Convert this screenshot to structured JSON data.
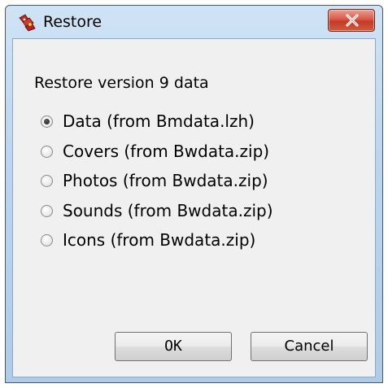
{
  "window": {
    "title": "Restore"
  },
  "dialog": {
    "heading": "Restore version 9 data",
    "options": [
      {
        "label": "Data (from Bmdata.lzh)",
        "checked": true
      },
      {
        "label": "Covers (from Bwdata.zip)",
        "checked": false
      },
      {
        "label": "Photos (from Bwdata.zip)",
        "checked": false
      },
      {
        "label": "Sounds (from Bwdata.zip)",
        "checked": false
      },
      {
        "label": "Icons (from Bwdata.zip)",
        "checked": false
      }
    ],
    "ok_label": "OK",
    "cancel_label": "Cancel"
  },
  "icons": {
    "app": "app-icon",
    "close": "close-icon"
  },
  "colors": {
    "titlebar": "#bcd6ef",
    "client_bg": "#f0f0f0",
    "close_button": "#c43a28"
  }
}
